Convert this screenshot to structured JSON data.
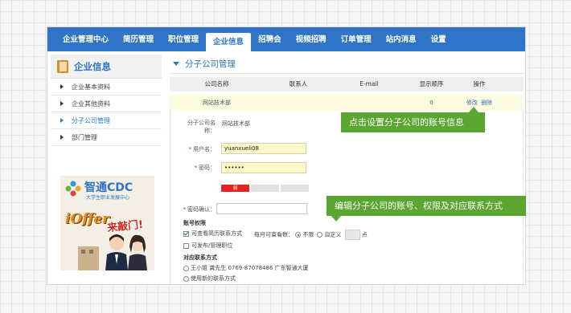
{
  "nav": {
    "items": [
      {
        "label": "企业管理中心"
      },
      {
        "label": "简历管理"
      },
      {
        "label": "职位管理"
      },
      {
        "label": "企业信息",
        "active": true
      },
      {
        "label": "招聘会"
      },
      {
        "label": "视频招聘"
      },
      {
        "label": "订单管理"
      },
      {
        "label": "站内消息"
      },
      {
        "label": "设置"
      }
    ]
  },
  "sidebar": {
    "title": "企业信息",
    "items": [
      {
        "label": "企业基本资料"
      },
      {
        "label": "企业其他资料"
      },
      {
        "label": "分子公司管理",
        "active": true
      },
      {
        "label": "部门管理"
      }
    ],
    "ad": {
      "logo_text": "智通CDC",
      "logo_sub": "大学生职业发展中心",
      "offer_text": "iOffer",
      "knock_text": "来敲门!"
    }
  },
  "main": {
    "title": "分子公司管理",
    "table": {
      "columns": [
        "公司名称",
        "联系人",
        "E-mail",
        "显示顺序",
        "操作"
      ],
      "rows": [
        {
          "name": "网站技术部",
          "contact": "",
          "email": "",
          "order": "0",
          "edit": "修改",
          "delete": "删除"
        }
      ]
    },
    "form": {
      "company_name_label": "分子公司名称：",
      "company_name_value": "网站技术部",
      "username_label": "用户名：",
      "username_value": "yuanxueli08",
      "password_label": "密码：",
      "password_value": "••••••",
      "strength_weak": "弱",
      "confirm_label": "密码确认：",
      "perm_section": "账号权限",
      "perm_view_resume": "可查看简历联系方式",
      "perm_daily_prefix": "每月可查看数：",
      "perm_unlimited": "不限",
      "perm_custom": "自定义",
      "perm_unit": "点",
      "perm_publish": "可发布/管理职位",
      "contact_section": "对应联系方式",
      "contact_existing": "王小姐  龚先生  0769-87078486  广东智通大厦",
      "contact_new": "使用新的联系方式"
    }
  },
  "callouts": {
    "account_info": "点击设置分子公司的账号信息",
    "permissions": "编辑分子公司的账号、权限及对应联系方式"
  },
  "colors": {
    "nav_blue": "#2f74c6",
    "callout_green": "#5ba531",
    "input_yellow": "#fbf9c9",
    "weak_red": "#e32424"
  }
}
